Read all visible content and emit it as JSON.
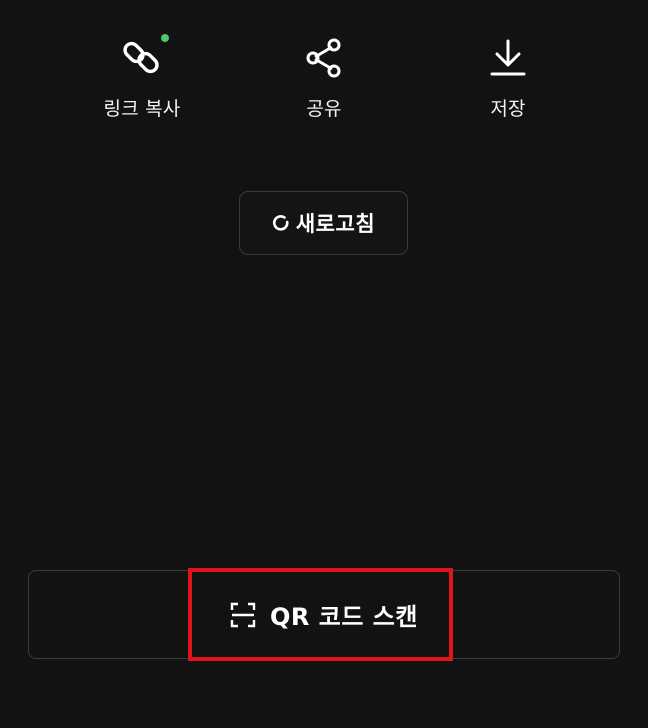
{
  "actions": {
    "copy_link": {
      "label": "링크 복사",
      "icon": "link-icon",
      "badge_color": "#4cc96a"
    },
    "share": {
      "label": "공유",
      "icon": "share-icon"
    },
    "save": {
      "label": "저장",
      "icon": "download-icon"
    }
  },
  "refresh_button": {
    "label": "새로고침",
    "icon": "refresh-icon"
  },
  "qr_scan_button": {
    "label": "QR 코드 스캔",
    "icon": "scan-icon"
  },
  "colors": {
    "background": "#121212",
    "text": "#ffffff",
    "highlight": "#e0141b",
    "badge": "#4cc96a"
  }
}
